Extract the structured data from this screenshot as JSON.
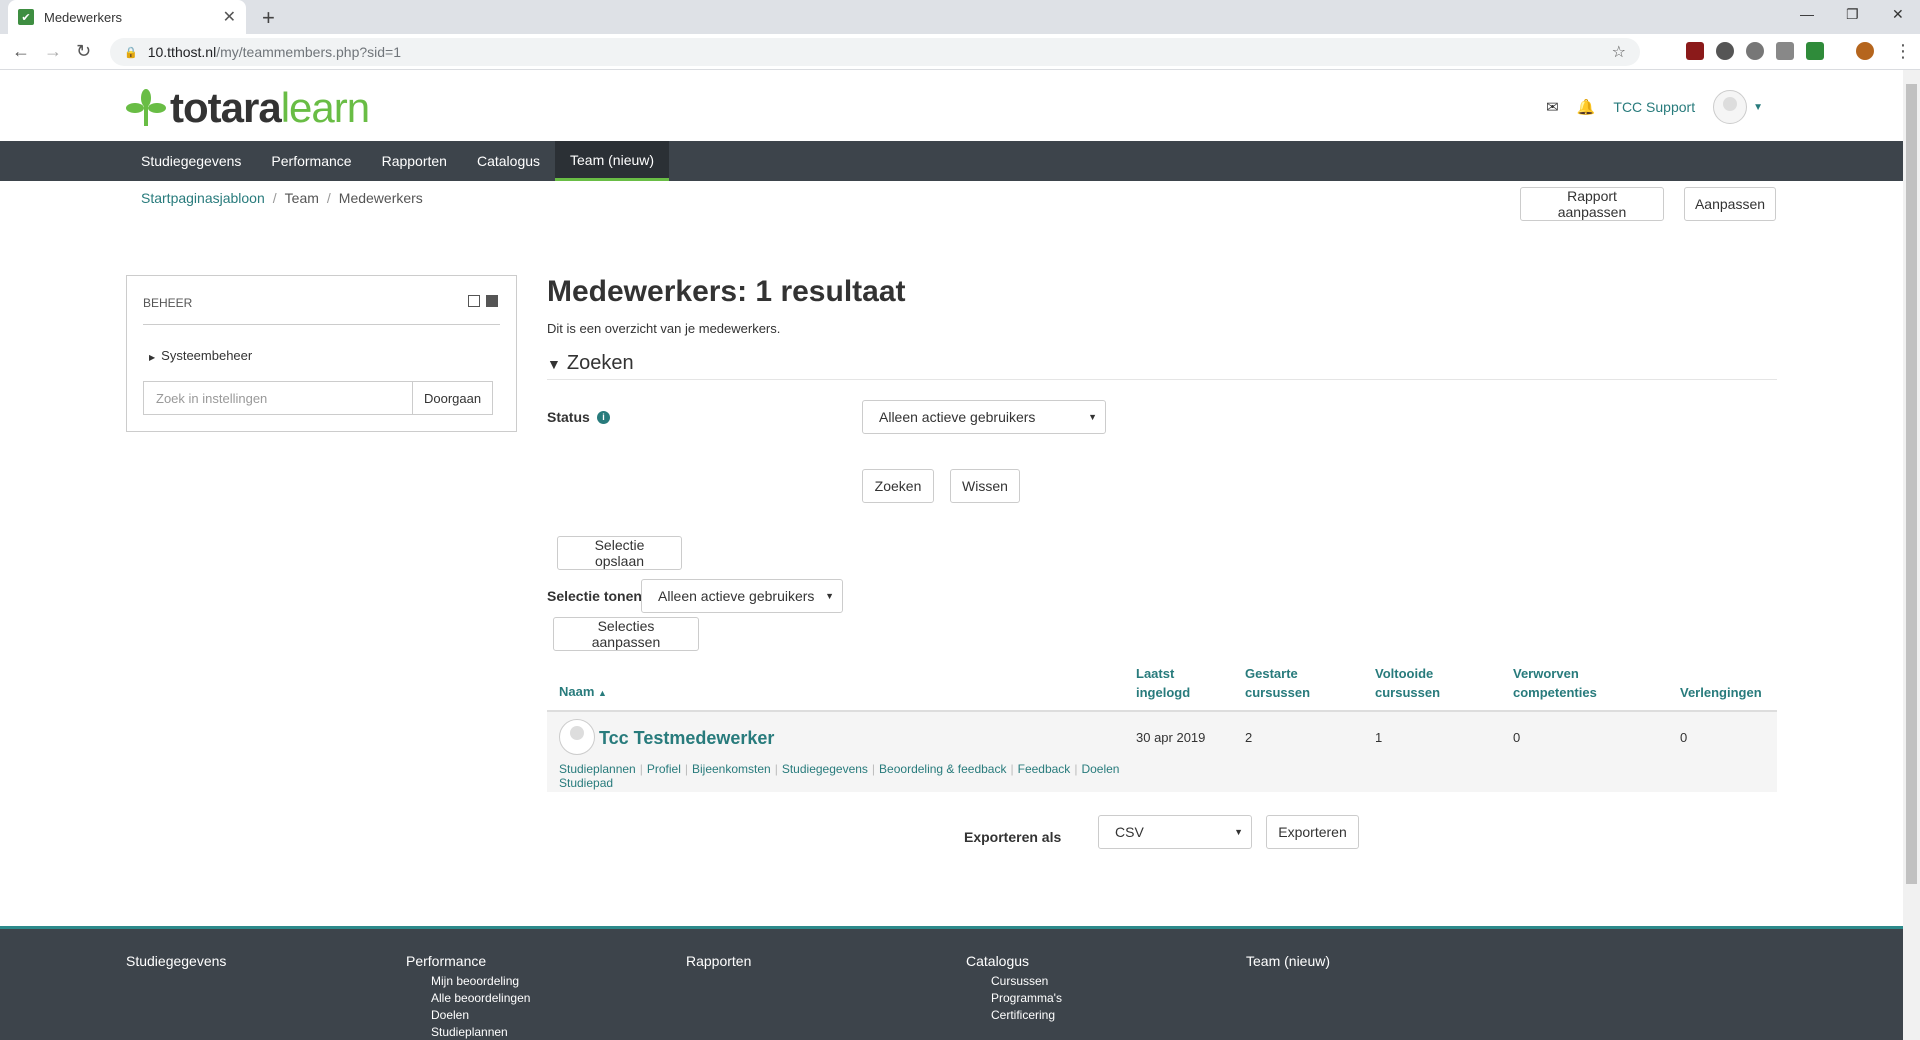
{
  "browser": {
    "tab_title": "Medewerkers",
    "url_host": "10.tthost.nl",
    "url_path": "/my/teammembers.php?sid=1"
  },
  "header": {
    "logo_part1": "totara",
    "logo_part2": "learn",
    "user_name": "TCC Support"
  },
  "nav": {
    "items": [
      "Studiegegevens",
      "Performance",
      "Rapporten",
      "Catalogus",
      "Team (nieuw)"
    ],
    "active": "Team (nieuw)"
  },
  "breadcrumb": [
    "Startpaginasjabloon",
    "Team",
    "Medewerkers"
  ],
  "top_buttons": {
    "customize_report": "Rapport aanpassen",
    "customize": "Aanpassen"
  },
  "admin_block": {
    "title": "BEHEER",
    "item": "Systeembeheer",
    "search_placeholder": "Zoek in instellingen",
    "search_button": "Doorgaan"
  },
  "main": {
    "title": "Medewerkers: 1 resultaat",
    "description": "Dit is een overzicht van je medewerkers.",
    "search_header": "Zoeken",
    "status_label": "Status",
    "status_value": "Alleen actieve gebruikers",
    "search_button": "Zoeken",
    "clear_button": "Wissen",
    "save_selection_button": "Selectie opslaan",
    "show_selection_label": "Selectie tonen",
    "show_selection_value": "Alleen actieve gebruikers",
    "edit_selections_button": "Selecties aanpassen"
  },
  "table": {
    "headers": {
      "name": "Naam",
      "last_login_1": "Laatst",
      "last_login_2": "ingelogd",
      "started_1": "Gestarte",
      "started_2": "cursussen",
      "completed_1": "Voltooide",
      "completed_2": "cursussen",
      "competencies_1": "Verworven",
      "competencies_2": "competenties",
      "extensions": "Verlengingen"
    },
    "row": {
      "name": "Tcc Testmedewerker",
      "last_login": "30 apr 2019",
      "started": "2",
      "completed": "1",
      "competencies": "0",
      "extensions": "0",
      "links": [
        "Studieplannen",
        "Profiel",
        "Bijeenkomsten",
        "Studiegegevens",
        "Beoordeling & feedback",
        "Feedback",
        "Doelen",
        "Studiepad"
      ]
    }
  },
  "export": {
    "label": "Exporteren als",
    "format": "CSV",
    "button": "Exporteren"
  },
  "footer": {
    "col1_title": "Studiegegevens",
    "col2_title": "Performance",
    "col2_items": [
      "Mijn beoordeling",
      "Alle beoordelingen",
      "Doelen",
      "Studieplannen"
    ],
    "col3_title": "Rapporten",
    "col4_title": "Catalogus",
    "col4_items": [
      "Cursussen",
      "Programma's",
      "Certificering"
    ],
    "col5_title": "Team (nieuw)"
  },
  "colors": {
    "brand_teal": "#287b7c",
    "nav_bg": "#3d444b",
    "logo_green": "#69bd45"
  }
}
